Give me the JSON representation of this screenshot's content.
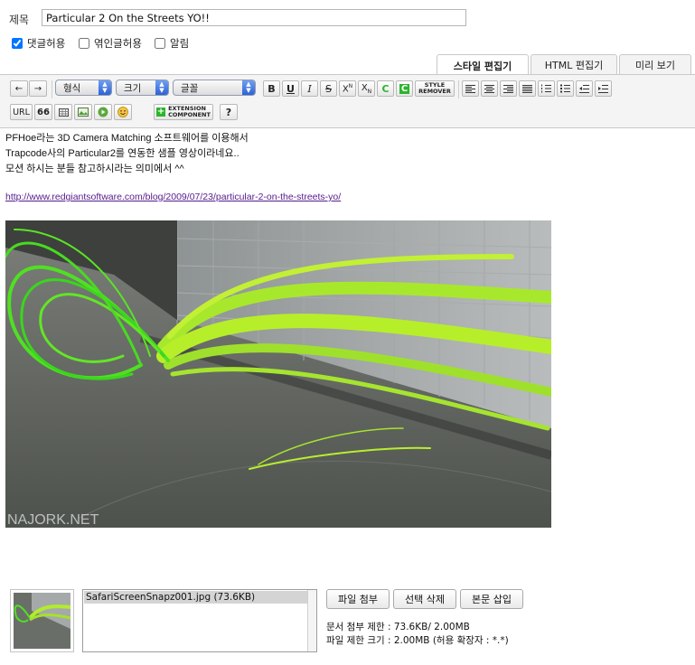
{
  "title": {
    "label": "제목",
    "value": "Particular 2 On the Streets YO!!"
  },
  "options": [
    {
      "label": "댓글허용",
      "checked": true
    },
    {
      "label": "엮인글허용",
      "checked": false
    },
    {
      "label": "알림",
      "checked": false
    }
  ],
  "tabs": [
    {
      "label": "스타일 편집기",
      "active": true
    },
    {
      "label": "HTML 편집기",
      "active": false
    },
    {
      "label": "미리 보기",
      "active": false
    }
  ],
  "toolbar": {
    "undo": "←",
    "redo": "→",
    "format_select": "형식",
    "size_select": "크기",
    "font_select": "글꼴",
    "bold": "B",
    "underline": "U",
    "italic": "I",
    "strike": "S",
    "superscript": "X",
    "superscript_mark": "N",
    "subscript": "X",
    "subscript_mark": "N",
    "color": "C",
    "bgcolor": "C",
    "style_remover_1": "STYLE",
    "style_remover_2": "REMOVER",
    "url": "URL",
    "quote": "66",
    "extension_1": "EXTENSION",
    "extension_2": "COMPONENT",
    "help": "?",
    "accent_green": "#2bb52b"
  },
  "content": {
    "lines": [
      "PFHoe라는 3D Camera Matching 소프트웨어를 이용해서",
      "Trapcode사의 Particular2를 연동한 샘플 영상이라네요..",
      "모션 하시는 분들 참고하시라는 의미에서 ^^"
    ],
    "link": "http://www.redgiantsoftware.com/blog/2009/07/23/particular-2-on-the-streets-yo/",
    "image_watermark": "NAJORK.NET"
  },
  "attachments": {
    "file_name": "SafariScreenSnapz001.jpg (73.6KB)",
    "buttons": [
      "파일 첨부",
      "선택 삭제",
      "본문 삽입"
    ],
    "limit_text": "문서 첨부 제한 : 73.6KB/ 2.00MB",
    "file_limit_text": "파일 제한 크기 : 2.00MB (허용 확장자 : *.*)"
  }
}
